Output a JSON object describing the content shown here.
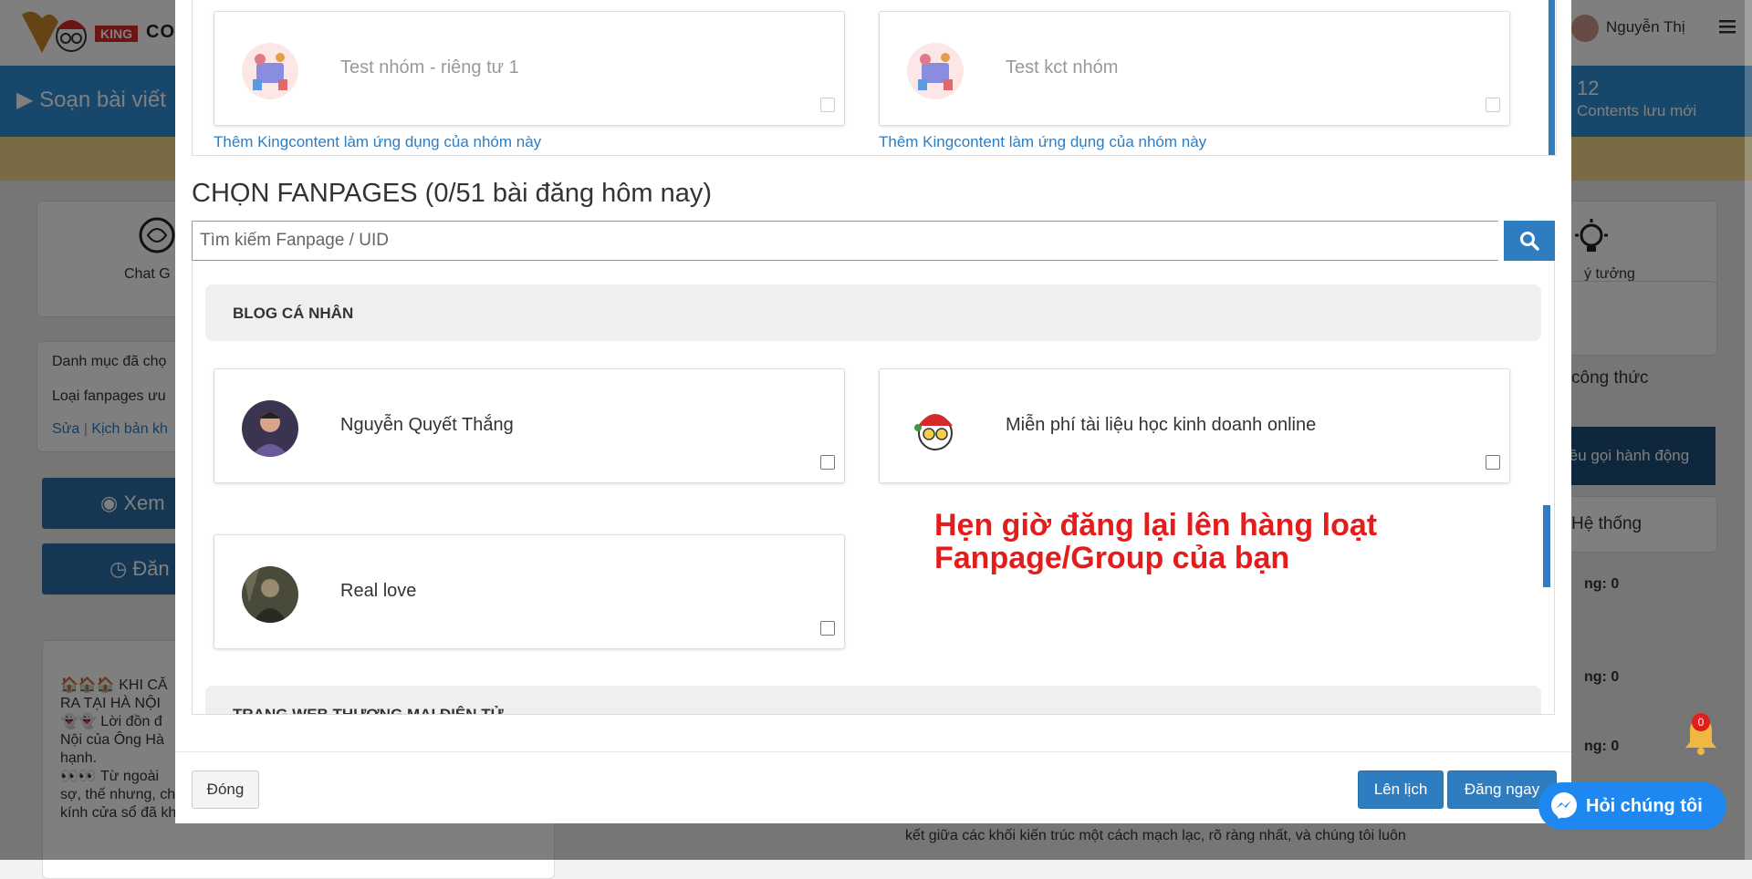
{
  "app": {
    "logo_badge": "KING",
    "logo_text": "CO",
    "user_name": "Nguyễn Thị",
    "compose_title": "Soạn bài viết",
    "stats_count": "12",
    "stats_label": "Contents lưu mới",
    "tool_left_label": "Chat G",
    "tool_right_label": "ý tưởng",
    "category_text": "Danh mục đã chọ",
    "fanpage_type_text": "Loại fanpages ưu",
    "edit_link": "Sửa",
    "script_link": "Kịch bản kh",
    "preview_button": "Xem",
    "post_button": "Đăn",
    "formula_label": "công thức",
    "cta_label": "iều gọi hành động",
    "system_label": "Hệ thống",
    "post_lines": [
      "🏠🏠🏠 KHI CĂ",
      "RA TẠI HÀ NỘI",
      "👻👻 Lời đồn đ",
      "Nội của Ông Hà",
      "hạnh.",
      "👀👀 Từ ngoài",
      "sợ, thế nhưng, chỉ cần bước vào, ánh nắng lạnh lùng phản chiếu từ",
      "kính cửa sổ đã khiến người ta sởn gai ốc."
    ],
    "right_lines": [
      "ng: 0",
      "ng: 0",
      "ng: 0"
    ],
    "right_bottom_text": "kết giữa các khối kiến trúc một cách mạch lạc, rõ ràng nhất, và chúng tôi luôn"
  },
  "modal": {
    "top_groups": [
      {
        "name": "Test nhóm - riêng tư 1",
        "link": "Thêm Kingcontent làm ứng dụng của nhóm này"
      },
      {
        "name": "Test kct nhóm",
        "link": "Thêm Kingcontent làm ứng dụng của nhóm này"
      }
    ],
    "fanpages_title": "CHỌN FANPAGES (0/51 bài đăng hôm nay)",
    "search_placeholder": "Tìm kiếm Fanpage / UID",
    "categories": [
      {
        "label": "BLOG CÁ NHÂN",
        "pages": [
          {
            "name": "Nguyễn Quyết Thắng",
            "checked": false
          },
          {
            "name": "Miễn phí tài liệu học kinh doanh online",
            "checked": false
          },
          {
            "name": "Real love",
            "checked": false
          }
        ]
      },
      {
        "label": "TRANG WEB THƯƠNG MẠI ĐIỆN TỬ",
        "pages": []
      }
    ],
    "promo_text": "Hẹn giờ đăng lại lên hàng loạt Fanpage/Group của bạn",
    "close_button": "Đóng",
    "schedule_button": "Lên lịch",
    "post_now_button": "Đăng ngay"
  },
  "widgets": {
    "chat_label": "Hỏi chúng tôi",
    "notification_count": "0"
  },
  "colors": {
    "primary": "#2e7dc0",
    "header_blue": "#2e8fd6",
    "promo_red": "#e31c1c",
    "messenger_blue": "#1e88f0"
  }
}
